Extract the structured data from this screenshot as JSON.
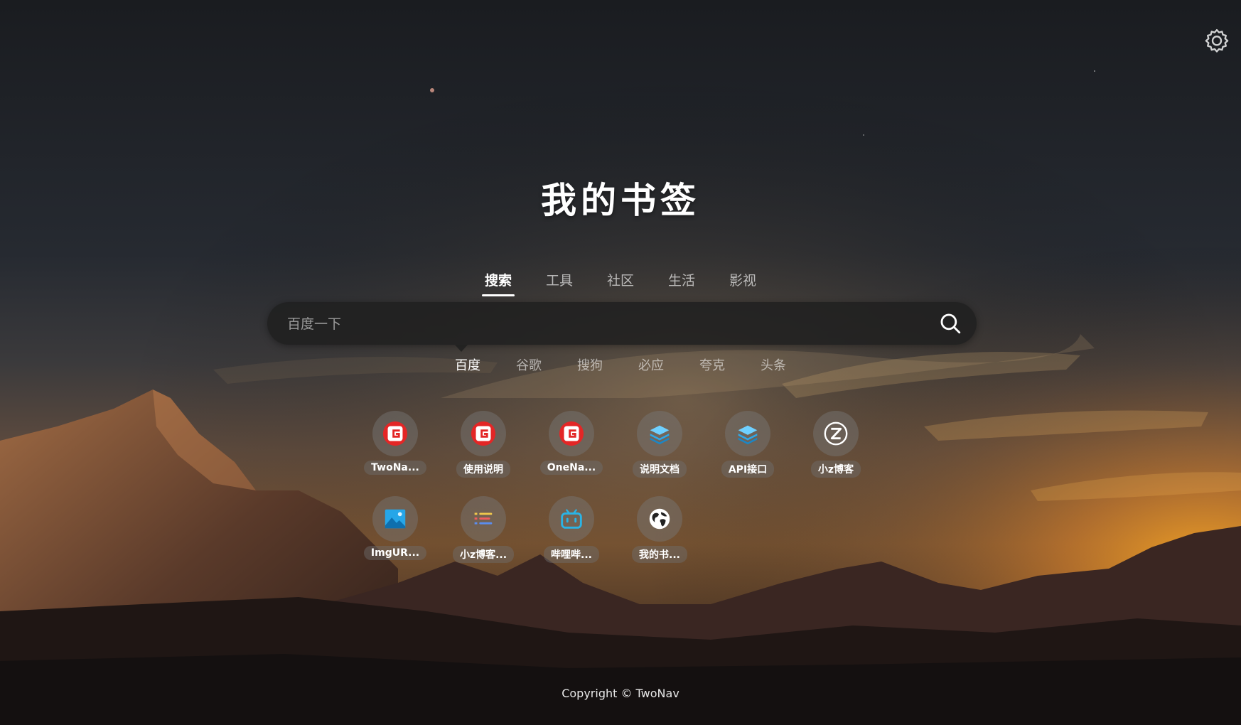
{
  "header": {
    "title": "我的书签"
  },
  "categories": [
    {
      "label": "搜索",
      "active": true
    },
    {
      "label": "工具",
      "active": false
    },
    {
      "label": "社区",
      "active": false
    },
    {
      "label": "生活",
      "active": false
    },
    {
      "label": "影视",
      "active": false
    }
  ],
  "search": {
    "placeholder": "百度一下",
    "value": ""
  },
  "engines": [
    {
      "label": "百度",
      "active": true
    },
    {
      "label": "谷歌",
      "active": false
    },
    {
      "label": "搜狗",
      "active": false
    },
    {
      "label": "必应",
      "active": false
    },
    {
      "label": "夸克",
      "active": false
    },
    {
      "label": "头条",
      "active": false
    }
  ],
  "bookmarks": [
    {
      "label": "TwoNa...",
      "icon": "g-logo-icon"
    },
    {
      "label": "使用说明",
      "icon": "g-logo-icon"
    },
    {
      "label": "OneNa...",
      "icon": "g-logo-icon"
    },
    {
      "label": "说明文档",
      "icon": "layers-icon"
    },
    {
      "label": "API接口",
      "icon": "layers-icon"
    },
    {
      "label": "小z博客",
      "icon": "z-circle-icon"
    },
    {
      "label": "ImgUR...",
      "icon": "image-icon"
    },
    {
      "label": "小z博客...",
      "icon": "list-icon"
    },
    {
      "label": "哔哩哔...",
      "icon": "bilibili-tv-icon"
    },
    {
      "label": "我的书...",
      "icon": "globe-icon"
    }
  ],
  "footer": {
    "copyright": "Copyright © TwoNav"
  },
  "colors": {
    "g_logo_red": "#e32626",
    "layers_blue": "#2fa8e8",
    "image_blue": "#26a6e8",
    "bilibili_blue": "#2ab4e6",
    "active_text": "#ffffff"
  }
}
